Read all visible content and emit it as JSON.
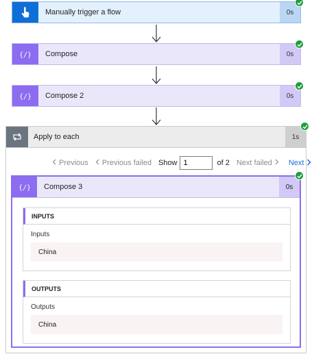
{
  "trigger": {
    "title": "Manually trigger a flow",
    "duration": "0s"
  },
  "compose1": {
    "title": "Compose",
    "duration": "0s"
  },
  "compose2": {
    "title": "Compose 2",
    "duration": "0s"
  },
  "apply": {
    "title": "Apply to each",
    "duration": "1s"
  },
  "pager": {
    "previous": "Previous",
    "previous_failed": "Previous failed",
    "show_label": "Show",
    "current": "1",
    "of_label": "of 2",
    "next_failed": "Next failed",
    "next": "Next"
  },
  "compose3": {
    "title": "Compose 3",
    "duration": "0s",
    "inputs": {
      "header": "INPUTS",
      "label": "Inputs",
      "value": "China"
    },
    "outputs": {
      "header": "OUTPUTS",
      "label": "Outputs",
      "value": "China"
    }
  },
  "colors": {
    "trigger_accent": "#0f6fd6",
    "compose_accent": "#8c6cf0",
    "apply_accent": "#6a7580",
    "success": "#1f9e3f",
    "link": "#1a6dd6"
  }
}
